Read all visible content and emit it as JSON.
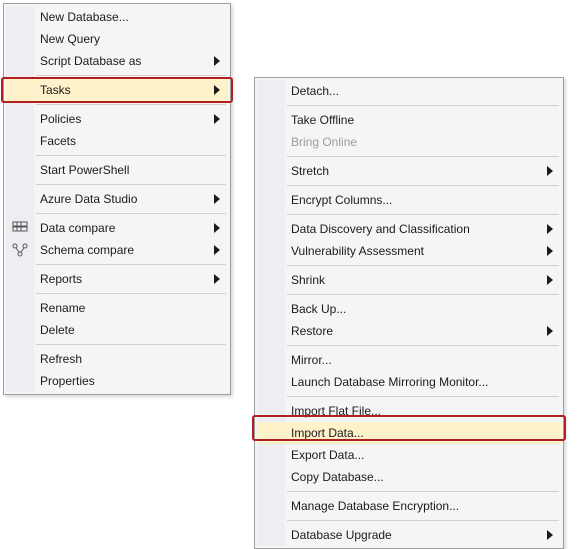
{
  "menu1": {
    "items": [
      {
        "label": "New Database...",
        "has_submenu": false
      },
      {
        "label": "New Query",
        "has_submenu": false
      },
      {
        "label": "Script Database as",
        "has_submenu": true
      },
      "---",
      {
        "label": "Tasks",
        "has_submenu": true,
        "highlighted": true
      },
      "---",
      {
        "label": "Policies",
        "has_submenu": true
      },
      {
        "label": "Facets",
        "has_submenu": false
      },
      "---",
      {
        "label": "Start PowerShell",
        "has_submenu": false
      },
      "---",
      {
        "label": "Azure Data Studio",
        "has_submenu": true
      },
      "---",
      {
        "label": "Data compare",
        "has_submenu": true,
        "icon": "data-compare"
      },
      {
        "label": "Schema compare",
        "has_submenu": true,
        "icon": "schema-compare"
      },
      "---",
      {
        "label": "Reports",
        "has_submenu": true
      },
      "---",
      {
        "label": "Rename",
        "has_submenu": false
      },
      {
        "label": "Delete",
        "has_submenu": false
      },
      "---",
      {
        "label": "Refresh",
        "has_submenu": false
      },
      {
        "label": "Properties",
        "has_submenu": false
      }
    ]
  },
  "menu2": {
    "items": [
      {
        "label": "Detach...",
        "has_submenu": false
      },
      "---",
      {
        "label": "Take Offline",
        "has_submenu": false
      },
      {
        "label": "Bring Online",
        "has_submenu": false,
        "disabled": true
      },
      "---",
      {
        "label": "Stretch",
        "has_submenu": true
      },
      "---",
      {
        "label": "Encrypt Columns...",
        "has_submenu": false
      },
      "---",
      {
        "label": "Data Discovery and Classification",
        "has_submenu": true
      },
      {
        "label": "Vulnerability Assessment",
        "has_submenu": true
      },
      "---",
      {
        "label": "Shrink",
        "has_submenu": true
      },
      "---",
      {
        "label": "Back Up...",
        "has_submenu": false
      },
      {
        "label": "Restore",
        "has_submenu": true
      },
      "---",
      {
        "label": "Mirror...",
        "has_submenu": false
      },
      {
        "label": "Launch Database Mirroring Monitor...",
        "has_submenu": false
      },
      "---",
      {
        "label": "Import Flat File...",
        "has_submenu": false
      },
      {
        "label": "Import Data...",
        "has_submenu": false,
        "highlighted": true
      },
      {
        "label": "Export Data...",
        "has_submenu": false
      },
      {
        "label": "Copy Database...",
        "has_submenu": false
      },
      "---",
      {
        "label": "Manage Database Encryption...",
        "has_submenu": false
      },
      "---",
      {
        "label": "Database Upgrade",
        "has_submenu": true
      }
    ]
  }
}
